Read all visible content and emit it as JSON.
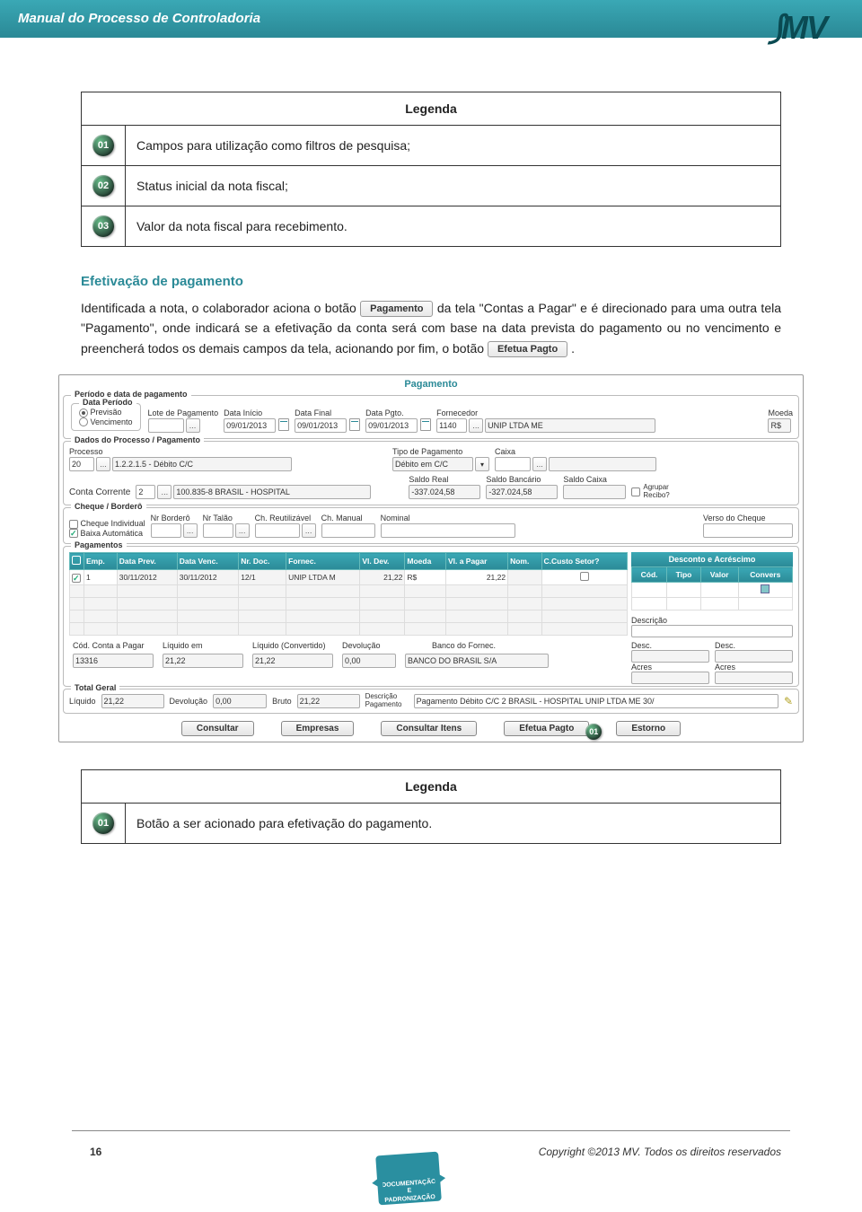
{
  "page": {
    "header_title": "Manual do Processo de Controladoria",
    "logo_text": "MV",
    "page_number": "16",
    "copyright": "Copyright ©2013 MV. Todos os direitos reservados",
    "stamp_line1": "DOCUMENTAÇÃO",
    "stamp_line2": "E PADRONIZAÇÃO"
  },
  "legend1": {
    "title": "Legenda",
    "rows": [
      {
        "num": "01",
        "text": "Campos para utilização como filtros de pesquisa;"
      },
      {
        "num": "02",
        "text": "Status inicial da nota fiscal;"
      },
      {
        "num": "03",
        "text": "Valor da nota fiscal para recebimento."
      }
    ]
  },
  "section_title": "Efetivação de pagamento",
  "para": {
    "p1a": "Identificada a nota, o colaborador aciona o botão ",
    "btn_pag": "Pagamento",
    "p1b": " da tela \"Contas a Pagar\" e é direcionado para uma outra tela \"Pagamento\", onde indicará se a efetivação da conta será com base na data prevista do pagamento ou no vencimento e preencherá todos os demais campos da tela, acionando por fim, o botão ",
    "btn_efetua": "Efetua Pagto",
    "p1c": "."
  },
  "app": {
    "title": "Pagamento",
    "fs_periodo": "Período e data de pagamento",
    "fs_data_periodo": "Data Período",
    "radio_prev": "Previsão",
    "radio_venc": "Vencimento",
    "lbl_lote": "Lote de Pagamento",
    "lbl_data_inicio": "Data Início",
    "val_data_inicio": "09/01/2013",
    "lbl_data_final": "Data Final",
    "val_data_final": "09/01/2013",
    "lbl_data_pgto": "Data Pgto.",
    "val_data_pgto": "09/01/2013",
    "lbl_fornecedor": "Fornecedor",
    "val_fornecedor_cod": "1140",
    "val_fornecedor_nome": "UNIP LTDA ME",
    "lbl_moeda": "Moeda",
    "val_moeda": "R$",
    "fs_dados_proc": "Dados do Processo / Pagamento",
    "lbl_processo": "Processo",
    "val_processo": "20",
    "val_processo_desc": "1.2.2.1.5 - Débito C/C",
    "lbl_tipo_pag": "Tipo de Pagamento",
    "val_tipo_pag": "Débito em C/C",
    "lbl_caixa": "Caixa",
    "lbl_conta_corr": "Conta Corrente",
    "val_conta_corr": "2",
    "val_conta_corr_desc": "100.835-8   BRASIL - HOSPITAL",
    "lbl_saldo_real": "Saldo Real",
    "val_saldo_real": "-337.024,58",
    "lbl_saldo_banc": "Saldo Bancário",
    "val_saldo_banc": "-327.024,58",
    "lbl_saldo_caixa": "Saldo Caixa",
    "lbl_agrupar": "Agrupar Recibo?",
    "fs_cheque": "Cheque / Borderô",
    "chk_cheque_ind": "Cheque Individual",
    "chk_baixa_auto": "Baixa Automática",
    "lbl_nr_bordero": "Nr Borderô",
    "lbl_nr_talao": "Nr Talão",
    "lbl_ch_reut": "Ch. Reutilizável",
    "lbl_ch_manual": "Ch. Manual",
    "lbl_nominal": "Nominal",
    "lbl_verso": "Verso do Cheque",
    "fs_pagamentos": "Pagamentos",
    "th": [
      "",
      "Emp.",
      "Data Prev.",
      "Data Venc.",
      "Nr. Doc.",
      "Fornec.",
      "Vl. Dev.",
      "Moeda",
      "Vl. a Pagar",
      "Nom.",
      "C.Custo Setor?"
    ],
    "row1": {
      "emp": "1",
      "prev": "30/11/2012",
      "venc": "30/11/2012",
      "doc": "12/1",
      "fornec": "UNIP LTDA M",
      "vldev": "21,22",
      "moeda": "R$",
      "vlp": "21,22"
    },
    "disc_title": "Desconto e Acréscimo",
    "side_th": [
      "Cód.",
      "Tipo",
      "Valor",
      "Convers"
    ],
    "lbl_descricao": "Descrição",
    "lbl_desc": "Desc.",
    "lbl_acres": "Acres",
    "tr_cod_conta": "Cód. Conta a Pagar",
    "tr_liquido_em": "Líquido em",
    "tr_liquido_conv": "Líquido (Convertido)",
    "tr_devolucao": "Devolução",
    "tr_banco_fornec": "Banco do Fornec.",
    "v_cod_conta": "13316",
    "v_liquido_em": "21,22",
    "v_liquido_conv": "21,22",
    "v_devolucao": "0,00",
    "v_banco": "BANCO DO BRASIL S/A",
    "fs_total": "Total Geral",
    "lbl_liquido": "Líquido",
    "v_liquido": "21,22",
    "lbl_devolucao2": "Devolução",
    "v_devolucao2": "0,00",
    "lbl_bruto": "Bruto",
    "v_bruto": "21,22",
    "lbl_desc_pag": "Descrição Pagamento",
    "v_desc_pag": "Pagamento Débito C/C 2 BRASIL - HOSPITAL UNIP LTDA ME 30/",
    "btns": [
      "Consultar",
      "Empresas",
      "Consultar Itens",
      "Efetua Pagto",
      "Estorno"
    ],
    "badge01": "01"
  },
  "legend2": {
    "title": "Legenda",
    "rows": [
      {
        "num": "01",
        "text": "Botão a ser acionado para efetivação do pagamento."
      }
    ]
  }
}
